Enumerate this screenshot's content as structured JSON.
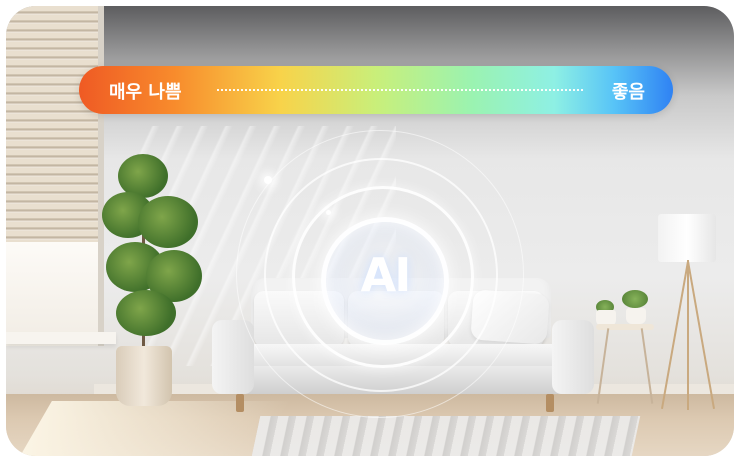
{
  "quality_bar": {
    "left_label": "매우 나쁨",
    "right_label": "좋음",
    "colors": [
      "#ef5a24",
      "#f8d34a",
      "#c9ef7a",
      "#8ef0e4",
      "#2f82f3"
    ]
  },
  "ai_badge": {
    "label": "AI"
  },
  "icons": [
    "ai-ring-icon"
  ]
}
